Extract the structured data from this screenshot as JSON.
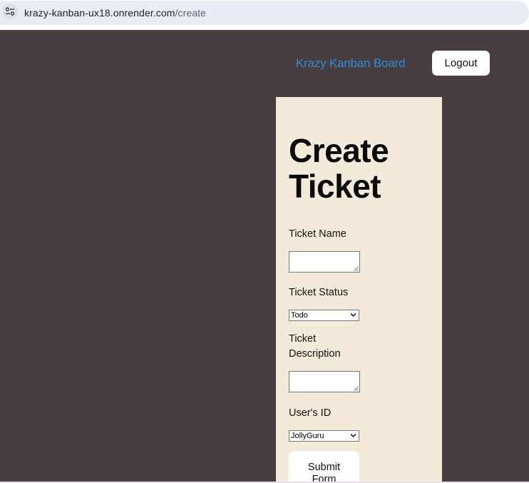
{
  "browser": {
    "url_host": "krazy-kanban-ux18.onrender.com",
    "url_path": "/create",
    "site_icon": "tune-icon"
  },
  "header": {
    "brand": "Krazy Kanban Board",
    "logout_label": "Logout"
  },
  "form": {
    "title": "Create Ticket",
    "ticket_name_label": "Ticket Name",
    "ticket_name_value": "",
    "ticket_status_label": "Ticket Status",
    "ticket_status_selected": "Todo",
    "ticket_description_label": "Ticket Description",
    "ticket_description_value": "",
    "user_id_label": "User's ID",
    "user_id_selected": "JollyGuru",
    "submit_label": "Submit Form"
  },
  "colors": {
    "page_background": "#483e3f",
    "card_background": "#f4eada",
    "brand_link": "#2d8cd6",
    "button_background": "#ffffff"
  }
}
